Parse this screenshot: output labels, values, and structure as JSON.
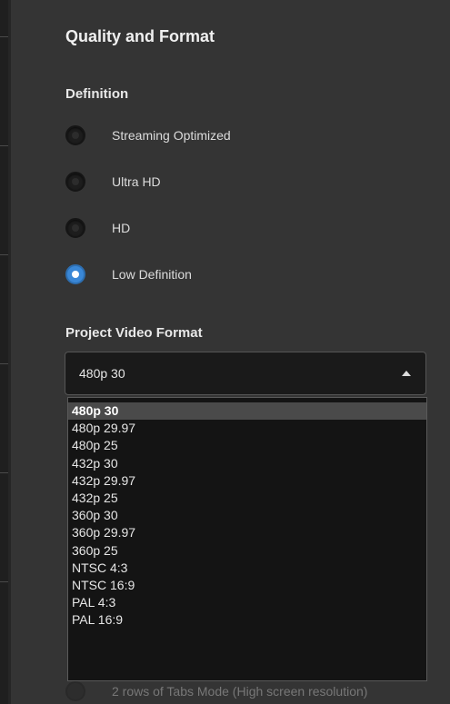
{
  "section": {
    "title": "Quality and Format"
  },
  "definition": {
    "label": "Definition",
    "options": [
      {
        "label": "Streaming Optimized",
        "checked": false
      },
      {
        "label": "Ultra HD",
        "checked": false
      },
      {
        "label": "HD",
        "checked": false
      },
      {
        "label": "Low Definition",
        "checked": true
      }
    ]
  },
  "video_format": {
    "label": "Project Video Format",
    "selected_value": "480p 30",
    "options": [
      "480p 30",
      "480p 29.97",
      "480p 25",
      "432p 30",
      "432p 29.97",
      "432p 25",
      "360p 30",
      "360p 29.97",
      "360p 25",
      "NTSC 4:3",
      "NTSC 16:9",
      "PAL 4:3",
      "PAL 16:9"
    ],
    "highlighted_index": 0
  },
  "hidden_option": {
    "label": "2 rows of Tabs Mode (High screen resolution)"
  },
  "colors": {
    "background": "#343434",
    "accent": "#3a87d6"
  }
}
